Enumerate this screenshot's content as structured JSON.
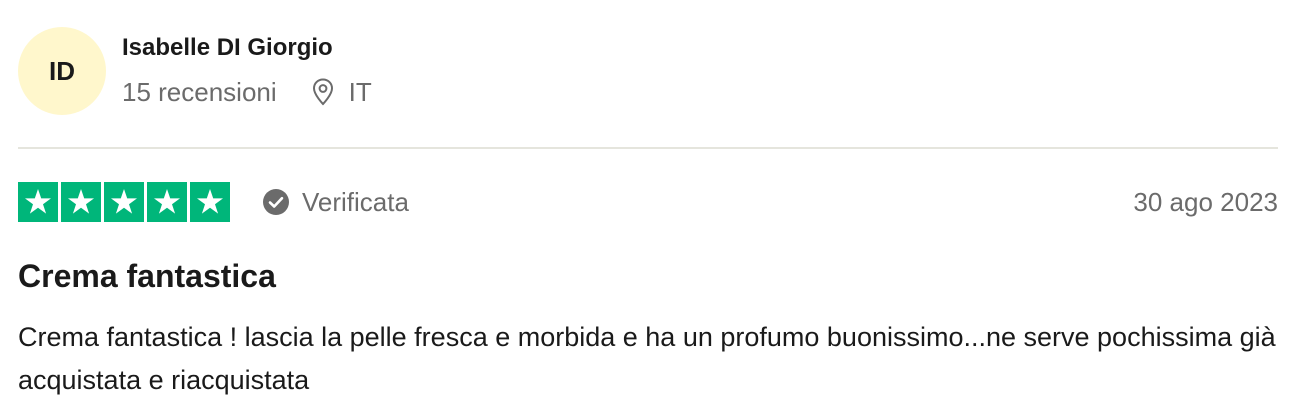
{
  "reviewer": {
    "initials": "ID",
    "name": "Isabelle DI Giorgio",
    "review_count": "15 recensioni",
    "country": "IT",
    "avatar_color": "#fff7cc"
  },
  "review": {
    "rating": 5,
    "max_rating": 5,
    "star_color": "#00b67a",
    "verified_label": "Verificata",
    "date": "30 ago 2023",
    "title": "Crema fantastica",
    "text": "Crema fantastica ! lascia la pelle fresca e morbida e ha un profumo buonissimo...ne serve pochissima già acquistata e riacquistata"
  },
  "icons": {
    "location": "location-pin-icon",
    "verified": "check-circle-icon",
    "star": "star-icon"
  }
}
